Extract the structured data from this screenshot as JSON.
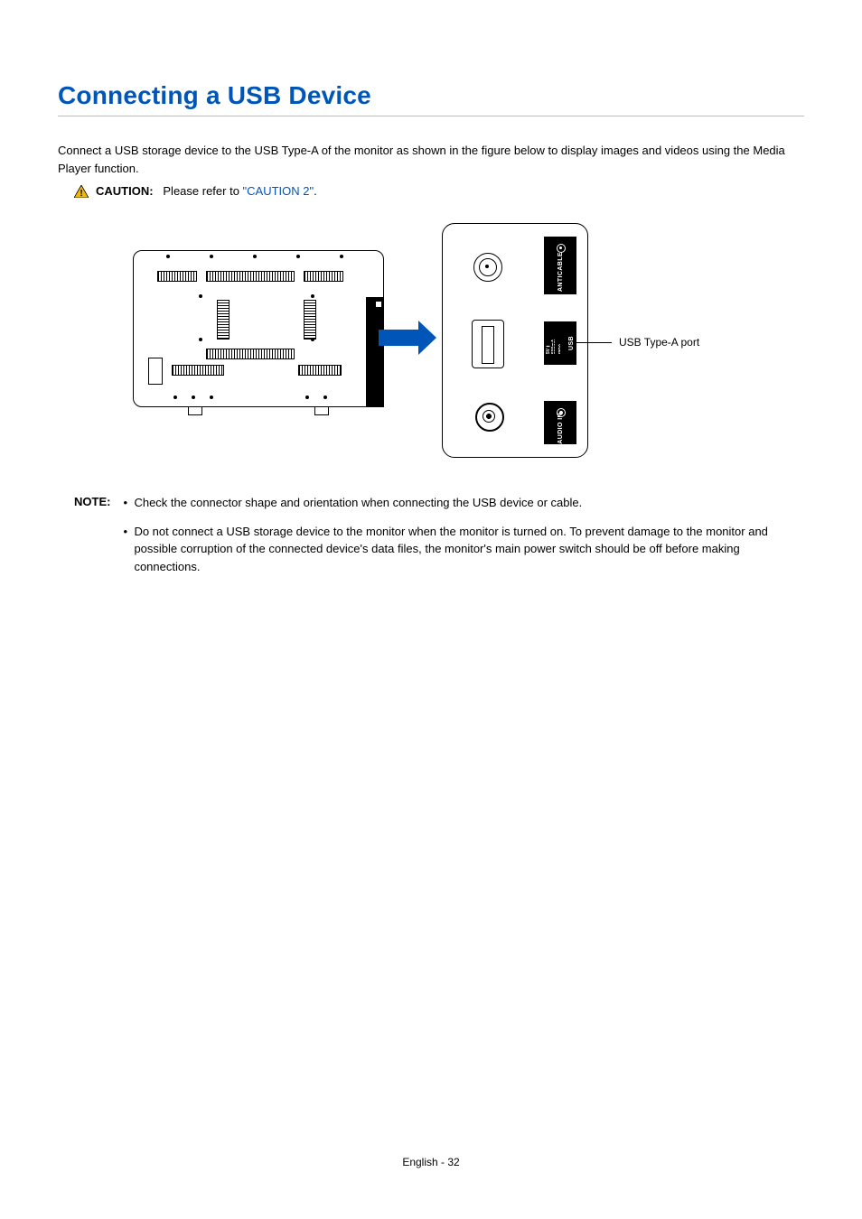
{
  "title": "Connecting a USB Device",
  "intro": "Connect a USB storage device to the USB Type-A of the monitor as shown in the figure below to display images and videos using the Media Player function.",
  "caution": {
    "label": "CAUTION:",
    "text_prefix": "Please refer to ",
    "link": "\"CAUTION 2\"",
    "text_suffix": "."
  },
  "figure": {
    "callout": "USB Type-A port",
    "labels": {
      "anticable": "ANTICABLE",
      "usb": "USB",
      "usb_small": "5V⎓ 500mA MAX",
      "audio": "AUDIO IN"
    }
  },
  "note": {
    "label": "NOTE:",
    "items": [
      "Check the connector shape and orientation when connecting the USB device or cable.",
      "Do not connect a USB storage device to the monitor when the monitor is turned on. To prevent damage to the monitor and possible corruption of the connected device's data files, the monitor's main power switch should be off before making connections."
    ]
  },
  "footer": "English - 32"
}
